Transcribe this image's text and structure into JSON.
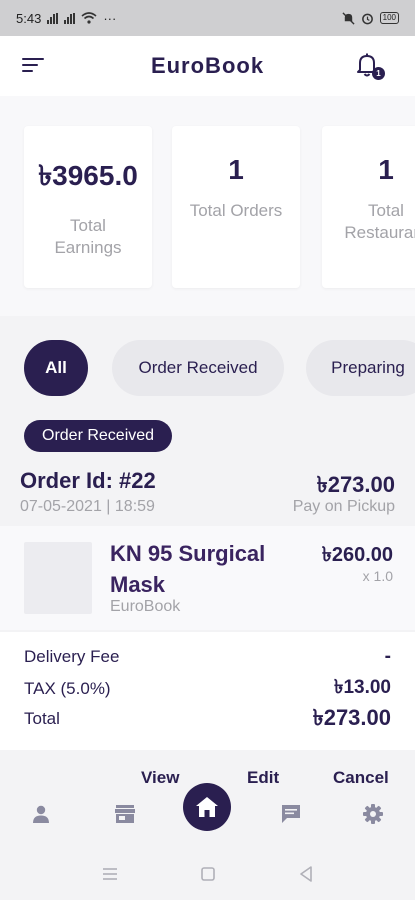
{
  "status_bar": {
    "time": "5:43",
    "signal_1": "ıll",
    "signal_2": "ıll",
    "more": "···",
    "battery": "100"
  },
  "header": {
    "title": "EuroBook",
    "notification_count": "1"
  },
  "stats": [
    {
      "value": "৳3965.0",
      "label_line1": "Total",
      "label_line2": "Earnings"
    },
    {
      "value": "1",
      "label_line1": "Total Orders",
      "label_line2": ""
    },
    {
      "value": "1",
      "label_line1": "Total",
      "label_line2": "Restaurant"
    }
  ],
  "filters": [
    {
      "label": "All",
      "active": true
    },
    {
      "label": "Order Received",
      "active": false
    },
    {
      "label": "Preparing",
      "active": false
    }
  ],
  "order": {
    "status_tag": "Order Received",
    "id": "Order Id: #22",
    "datetime": "07-05-2021 | 18:59",
    "amount": "৳273.00",
    "payment": "Pay on Pickup",
    "item": {
      "name": "KN 95 Surgical Mask",
      "vendor": "EuroBook",
      "price": "৳260.00",
      "qty": "x 1.0"
    },
    "totals": {
      "delivery_label": "Delivery Fee",
      "delivery_value": "-",
      "tax_label": "TAX (5.0%)",
      "tax_value": "৳13.00",
      "total_label": "Total",
      "total_value": "৳273.00"
    },
    "actions": {
      "view": "View",
      "edit": "Edit",
      "cancel": "Cancel"
    }
  },
  "bottom_nav": [
    "profile-icon",
    "store-icon",
    "home-icon",
    "chat-icon",
    "settings-icon"
  ],
  "colors": {
    "primary": "#2a1f50",
    "muted": "#a3a3a8",
    "chip": "#e8e8ec"
  }
}
